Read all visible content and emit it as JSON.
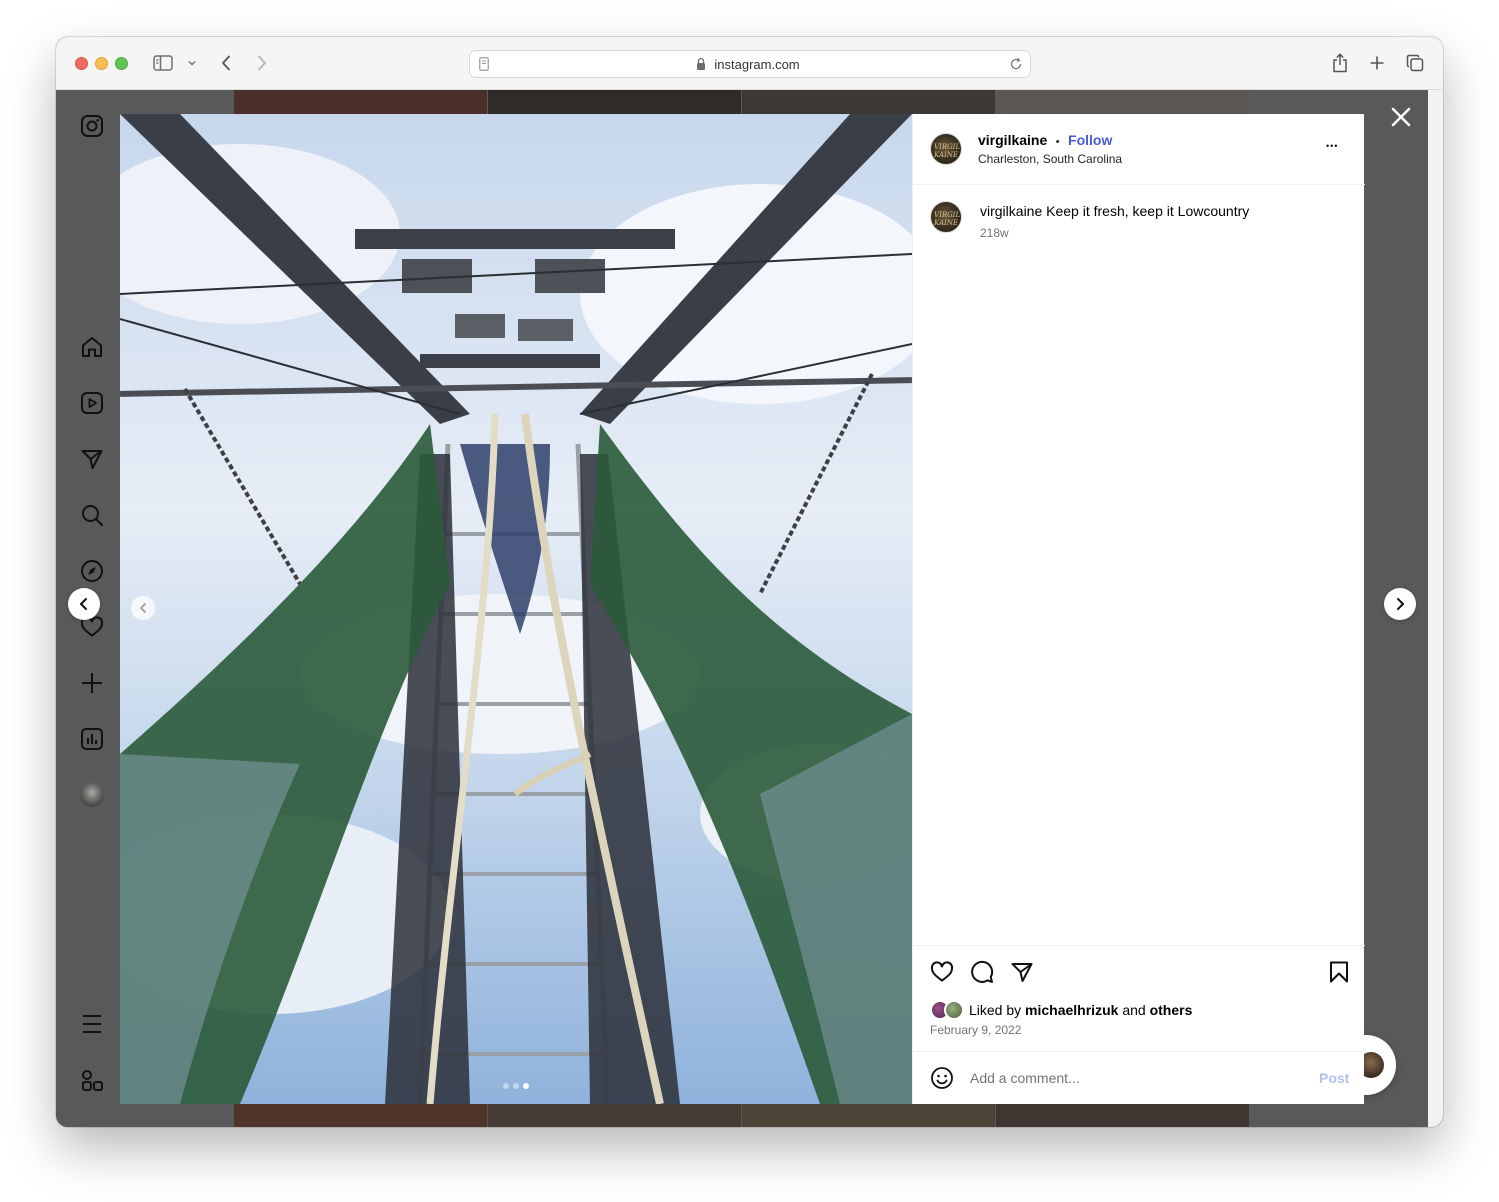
{
  "browser": {
    "url": "instagram.com"
  },
  "post": {
    "username": "virgilkaine",
    "separator": "•",
    "follow_label": "Follow",
    "location": "Charleston, South Carolina",
    "more_label": "•••",
    "caption_user": "virgilkaine",
    "caption_text": "Keep it fresh, keep it Lowcountry",
    "caption_age": "218w",
    "avatar_text": "VIRGIL KAINE",
    "liked_prefix": "Liked by",
    "liked_user": "michaelhrizuk",
    "liked_and": "and",
    "liked_others": "others",
    "date": "February 9, 2022",
    "comment_placeholder": "Add a comment...",
    "post_button": "Post",
    "carousel": {
      "count": 3,
      "active": 3
    }
  },
  "colors": {
    "follow": "#4a5bd6",
    "post_button_disabled": "#b3c0f5",
    "page_bg": "#58595b"
  },
  "icons": {
    "sidebar": [
      "instagram-logo-icon",
      "home-icon",
      "reels-icon",
      "direct-icon",
      "search-icon",
      "explore-icon",
      "heart-icon",
      "create-icon",
      "dashboard-icon",
      "profile-avatar",
      "menu-icon",
      "threads-apps-icon"
    ],
    "actions": [
      "heart-icon",
      "comment-icon",
      "share-icon",
      "bookmark-icon"
    ]
  }
}
